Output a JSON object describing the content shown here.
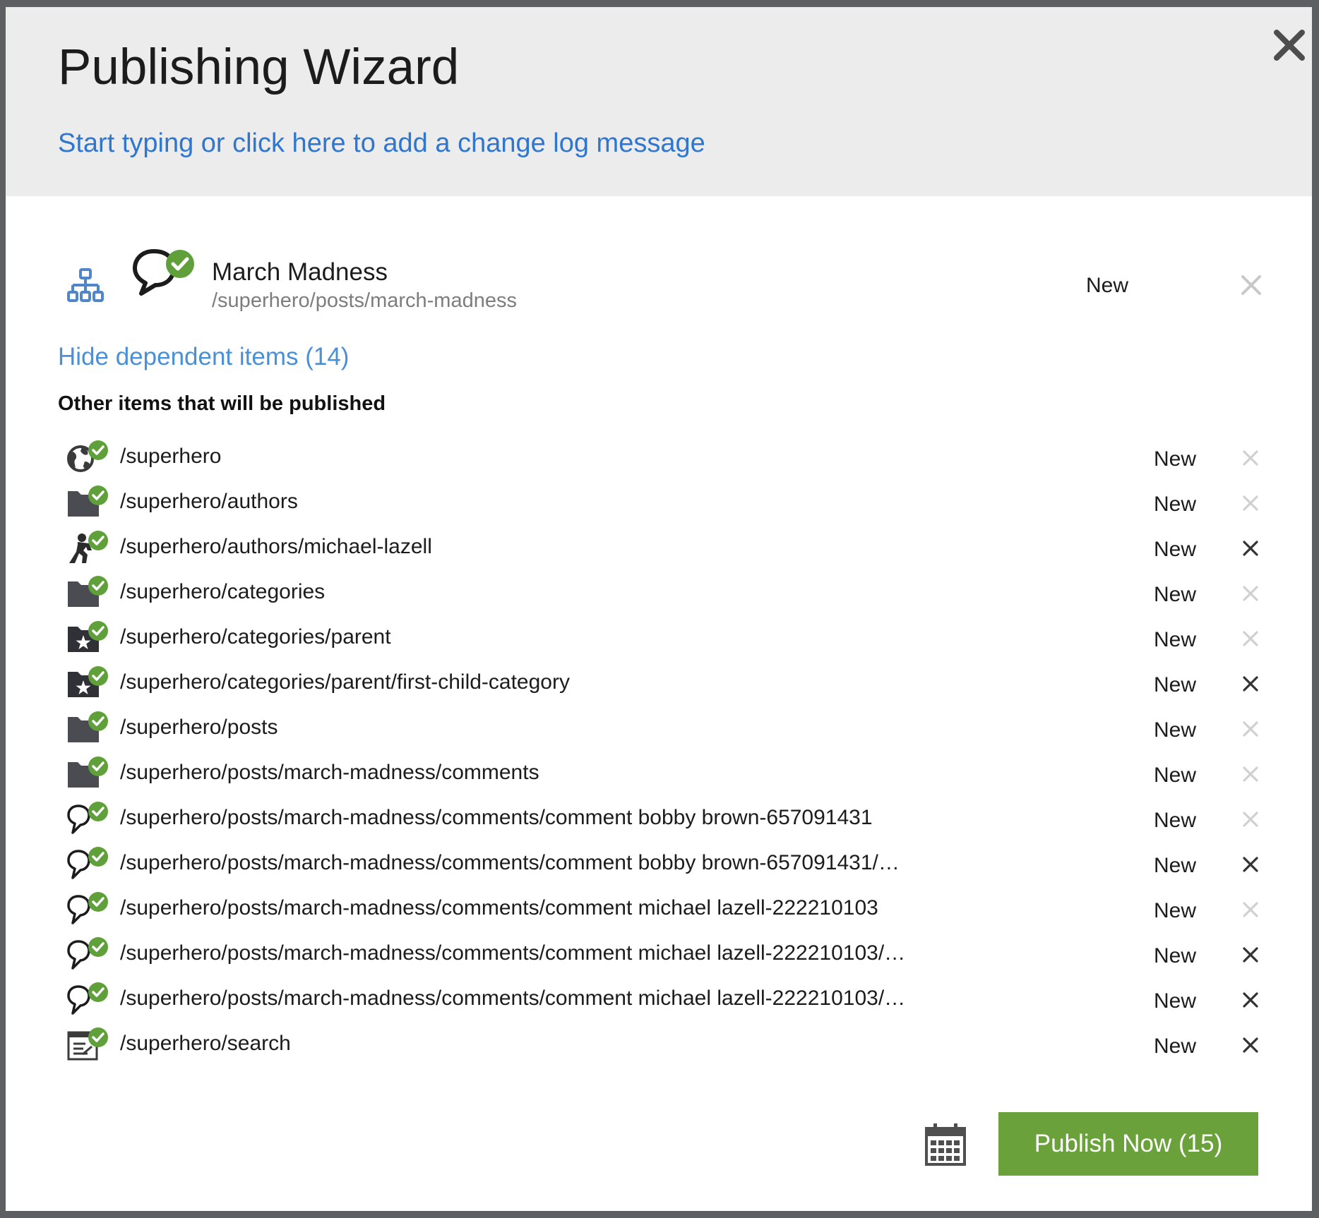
{
  "dialog": {
    "title": "Publishing Wizard",
    "changelog_prompt": "Start typing or click here to add a change log message",
    "close_icon": "close-icon"
  },
  "main_item": {
    "title": "March Madness",
    "path": "/superhero/posts/march-madness",
    "status": "New",
    "type_icon": "chat-bubble-icon",
    "structure_icon": "sitemap-icon"
  },
  "dependents": {
    "toggle_label": "Hide dependent items (14)",
    "heading": "Other items that will be published",
    "items": [
      {
        "path": "/superhero",
        "status": "New",
        "icon": "globe-icon",
        "removable": false
      },
      {
        "path": "/superhero/authors",
        "status": "New",
        "icon": "folder-icon",
        "removable": false
      },
      {
        "path": "/superhero/authors/michael-lazell",
        "status": "New",
        "icon": "author-icon",
        "removable": true
      },
      {
        "path": "/superhero/categories",
        "status": "New",
        "icon": "folder-icon",
        "removable": false
      },
      {
        "path": "/superhero/categories/parent",
        "status": "New",
        "icon": "category-icon",
        "removable": false
      },
      {
        "path": "/superhero/categories/parent/first-child-category",
        "status": "New",
        "icon": "category-icon",
        "removable": true
      },
      {
        "path": "/superhero/posts",
        "status": "New",
        "icon": "folder-icon",
        "removable": false
      },
      {
        "path": "/superhero/posts/march-madness/comments",
        "status": "New",
        "icon": "folder-icon",
        "removable": false
      },
      {
        "path": "/superhero/posts/march-madness/comments/comment bobby brown-657091431",
        "status": "New",
        "icon": "comment-icon",
        "removable": false
      },
      {
        "path": "/superhero/posts/march-madness/comments/comment bobby brown-657091431/…",
        "status": "New",
        "icon": "comment-icon",
        "removable": true
      },
      {
        "path": "/superhero/posts/march-madness/comments/comment michael lazell-222210103",
        "status": "New",
        "icon": "comment-icon",
        "removable": false
      },
      {
        "path": "/superhero/posts/march-madness/comments/comment michael lazell-222210103/…",
        "status": "New",
        "icon": "comment-icon",
        "removable": true
      },
      {
        "path": "/superhero/posts/march-madness/comments/comment michael lazell-222210103/…",
        "status": "New",
        "icon": "comment-icon",
        "removable": true
      },
      {
        "path": "/superhero/search",
        "status": "New",
        "icon": "search-page-icon",
        "removable": true
      }
    ]
  },
  "footer": {
    "schedule_icon": "calendar-icon",
    "publish_label": "Publish Now (15)"
  },
  "colors": {
    "header_bg": "#ececec",
    "link": "#2f76d0",
    "toggle_link": "#4a90d9",
    "publish_green": "#6aa13b",
    "check_green": "#5fa03a",
    "remove_active": "#333333",
    "remove_disabled": "#d0d0d0"
  }
}
